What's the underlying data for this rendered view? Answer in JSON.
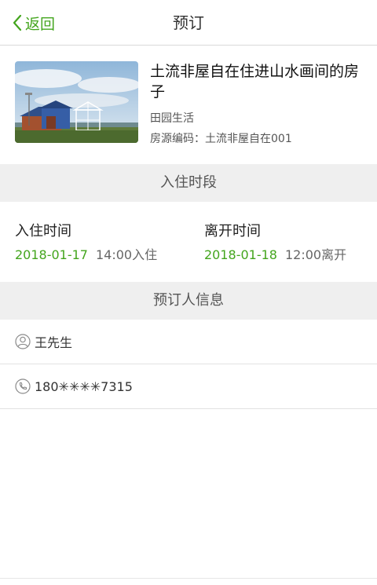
{
  "header": {
    "back_label": "返回",
    "title": "预订"
  },
  "listing": {
    "title": "土流非屋自在住进山水画间的房子",
    "category": "田园生活",
    "code_label": "房源编码：土流非屋自在001"
  },
  "stay": {
    "section_title": "入住时段",
    "checkin": {
      "label": "入住时间",
      "date": "2018-01-17",
      "time": "14:00入住"
    },
    "checkout": {
      "label": "离开时间",
      "date": "2018-01-18",
      "time": "12:00离开"
    }
  },
  "booker": {
    "section_title": "预订人信息",
    "name": "王先生",
    "phone": "180✳✳✳✳7315"
  },
  "colors": {
    "accent": "#43a51d",
    "band": "#efefef"
  },
  "icons": {
    "back": "chevron-left-icon",
    "person": "person-icon",
    "phone": "phone-icon"
  }
}
